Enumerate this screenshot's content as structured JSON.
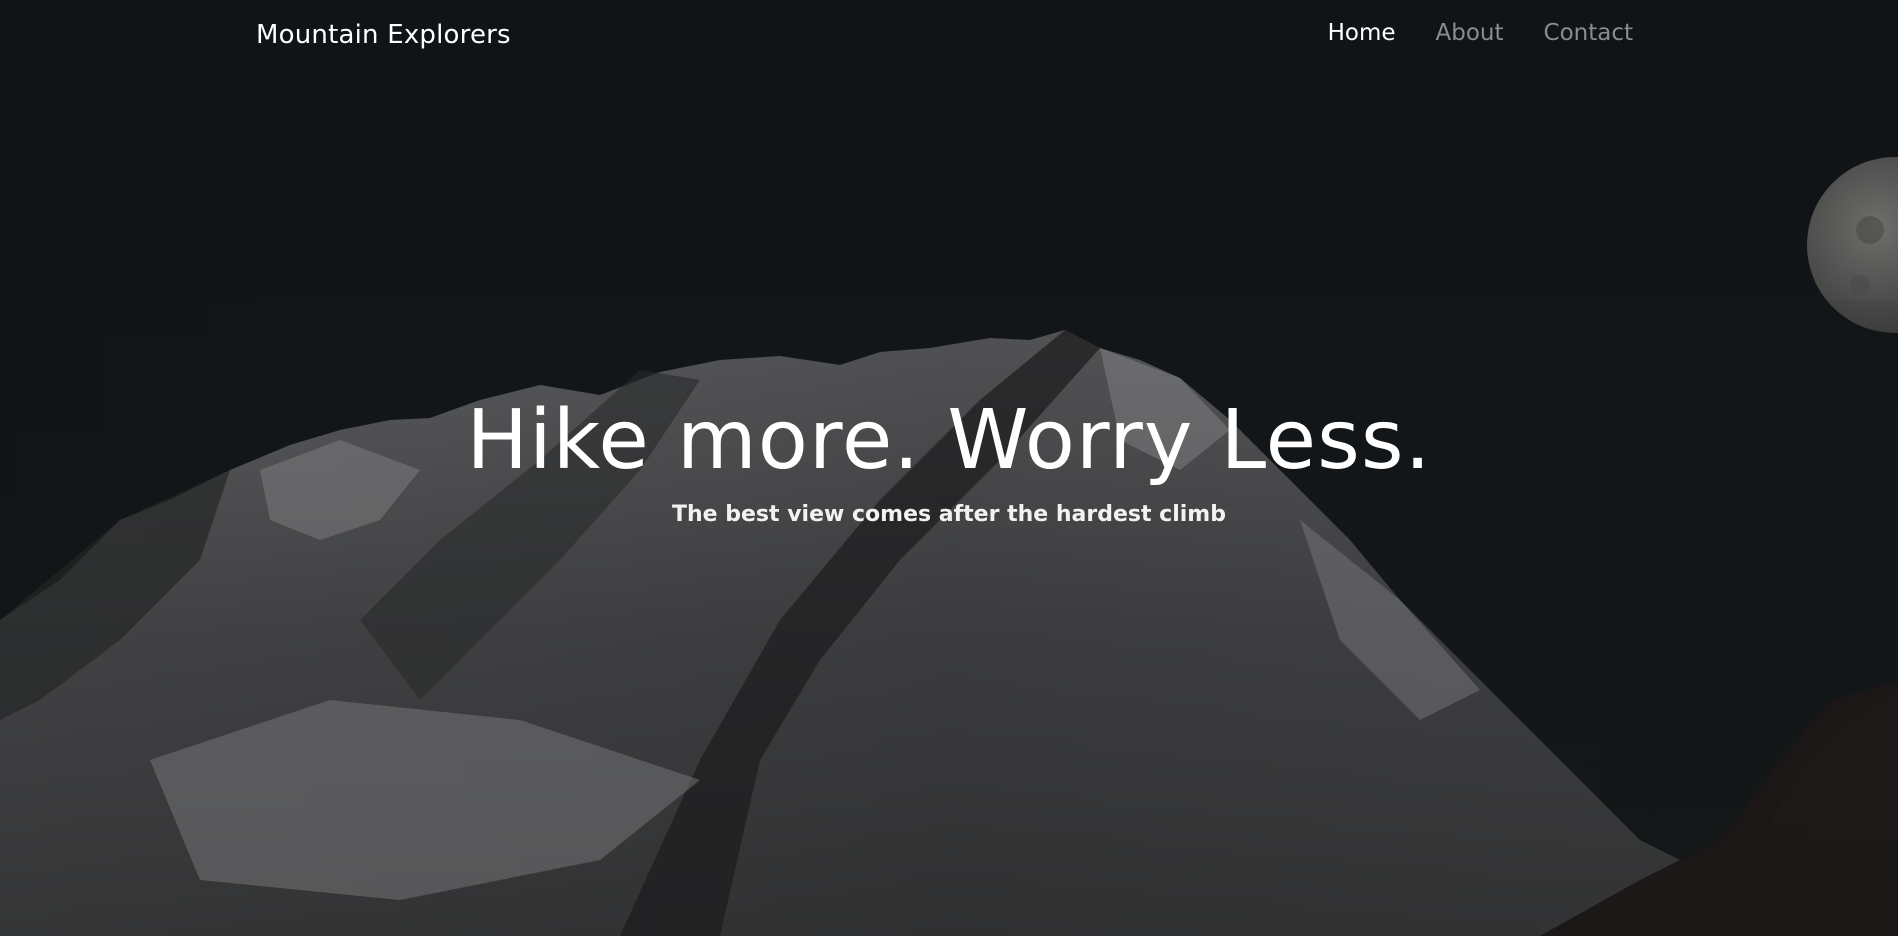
{
  "nav": {
    "brand": "Mountain Explorers",
    "links": [
      {
        "label": "Home",
        "active": true
      },
      {
        "label": "About",
        "active": false
      },
      {
        "label": "Contact",
        "active": false
      }
    ]
  },
  "hero": {
    "headline": "Hike more. Worry Less.",
    "subheadline": "The best view comes after the hardest climb",
    "background_image": "mountain-night-photo",
    "colors": {
      "sky": "#0f1314",
      "text": "#ffffff",
      "inactive_link": "#8a8d8f"
    }
  }
}
